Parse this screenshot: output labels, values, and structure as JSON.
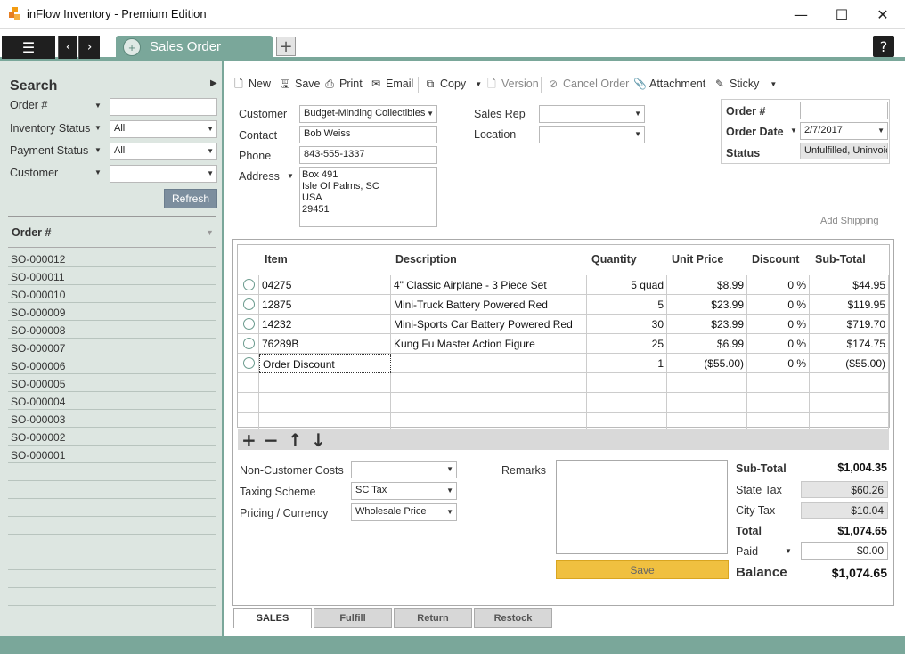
{
  "window": {
    "title": "inFlow Inventory - Premium Edition",
    "minimize": "—",
    "maximize": "☐",
    "close": "✕"
  },
  "tabs": {
    "active": "Sales Order",
    "add": "+",
    "help": "?"
  },
  "search": {
    "title": "Search",
    "fields": [
      {
        "label": "Order #",
        "value": ""
      },
      {
        "label": "Inventory Status",
        "value": "All"
      },
      {
        "label": "Payment Status",
        "value": "All"
      },
      {
        "label": "Customer",
        "value": ""
      }
    ],
    "refresh": "Refresh"
  },
  "order_list": {
    "header": "Order #",
    "items": [
      "SO-000012",
      "SO-000011",
      "SO-000010",
      "SO-000009",
      "SO-000008",
      "SO-000007",
      "SO-000006",
      "SO-000005",
      "SO-000004",
      "SO-000003",
      "SO-000002",
      "SO-000001"
    ]
  },
  "toolbar": {
    "new": "New",
    "save": "Save",
    "print": "Print",
    "email": "Email",
    "copy": "Copy",
    "version": "Version",
    "cancel_order": "Cancel Order",
    "attachment": "Attachment",
    "sticky": "Sticky"
  },
  "customer": {
    "customer_label": "Customer",
    "customer_value": "Budget-Minding Collectibles",
    "contact_label": "Contact",
    "contact_value": "Bob Weiss",
    "phone_label": "Phone",
    "phone_value": "843-555-1337",
    "address_label": "Address",
    "address_lines": [
      "Box 491",
      "Isle Of Palms, SC",
      "USA",
      "29451"
    ],
    "sales_rep_label": "Sales Rep",
    "sales_rep_value": "",
    "location_label": "Location",
    "location_value": ""
  },
  "order_info": {
    "order_no_label": "Order #",
    "order_no_value": "",
    "order_date_label": "Order Date",
    "order_date_value": "2/7/2017",
    "status_label": "Status",
    "status_value": "Unfulfilled, Uninvoic"
  },
  "add_shipping": "Add Shipping",
  "grid": {
    "columns": [
      "Item",
      "Description",
      "Quantity",
      "Unit Price",
      "Discount",
      "Sub-Total"
    ],
    "rows": [
      {
        "item": "04275",
        "description": "4\" Classic Airplane - 3 Piece Set",
        "quantity": "5 quad",
        "unit_price": "$8.99",
        "discount": "0 %",
        "subtotal": "$44.95"
      },
      {
        "item": "12875",
        "description": "Mini-Truck Battery Powered Red",
        "quantity": "5",
        "unit_price": "$23.99",
        "discount": "0 %",
        "subtotal": "$119.95"
      },
      {
        "item": "14232",
        "description": "Mini-Sports Car Battery Powered Red",
        "quantity": "30",
        "unit_price": "$23.99",
        "discount": "0 %",
        "subtotal": "$719.70"
      },
      {
        "item": "76289B",
        "description": "Kung Fu Master Action Figure",
        "quantity": "25",
        "unit_price": "$6.99",
        "discount": "0 %",
        "subtotal": "$174.75"
      },
      {
        "item": "Order Discount",
        "description": "",
        "quantity": "1",
        "unit_price": "($55.00)",
        "discount": "0 %",
        "subtotal": "($55.00)"
      }
    ]
  },
  "bottom": {
    "non_customer_costs_label": "Non-Customer Costs",
    "non_customer_costs_value": "",
    "taxing_scheme_label": "Taxing Scheme",
    "taxing_scheme_value": "SC Tax",
    "pricing_label": "Pricing / Currency",
    "pricing_value": "Wholesale Price",
    "remarks_label": "Remarks",
    "save": "Save"
  },
  "totals": {
    "subtotal_label": "Sub-Total",
    "subtotal_value": "$1,004.35",
    "state_tax_label": "State Tax",
    "state_tax_value": "$60.26",
    "city_tax_label": "City Tax",
    "city_tax_value": "$10.04",
    "total_label": "Total",
    "total_value": "$1,074.65",
    "paid_label": "Paid",
    "paid_value": "$0.00",
    "balance_label": "Balance",
    "balance_value": "$1,074.65"
  },
  "bottom_tabs": [
    "SALES",
    "Fulfill",
    "Return",
    "Restock"
  ],
  "colors": {
    "accent": "#7aa79a",
    "save_button": "#f0c040",
    "sidebar_bg": "#dde6e1"
  }
}
